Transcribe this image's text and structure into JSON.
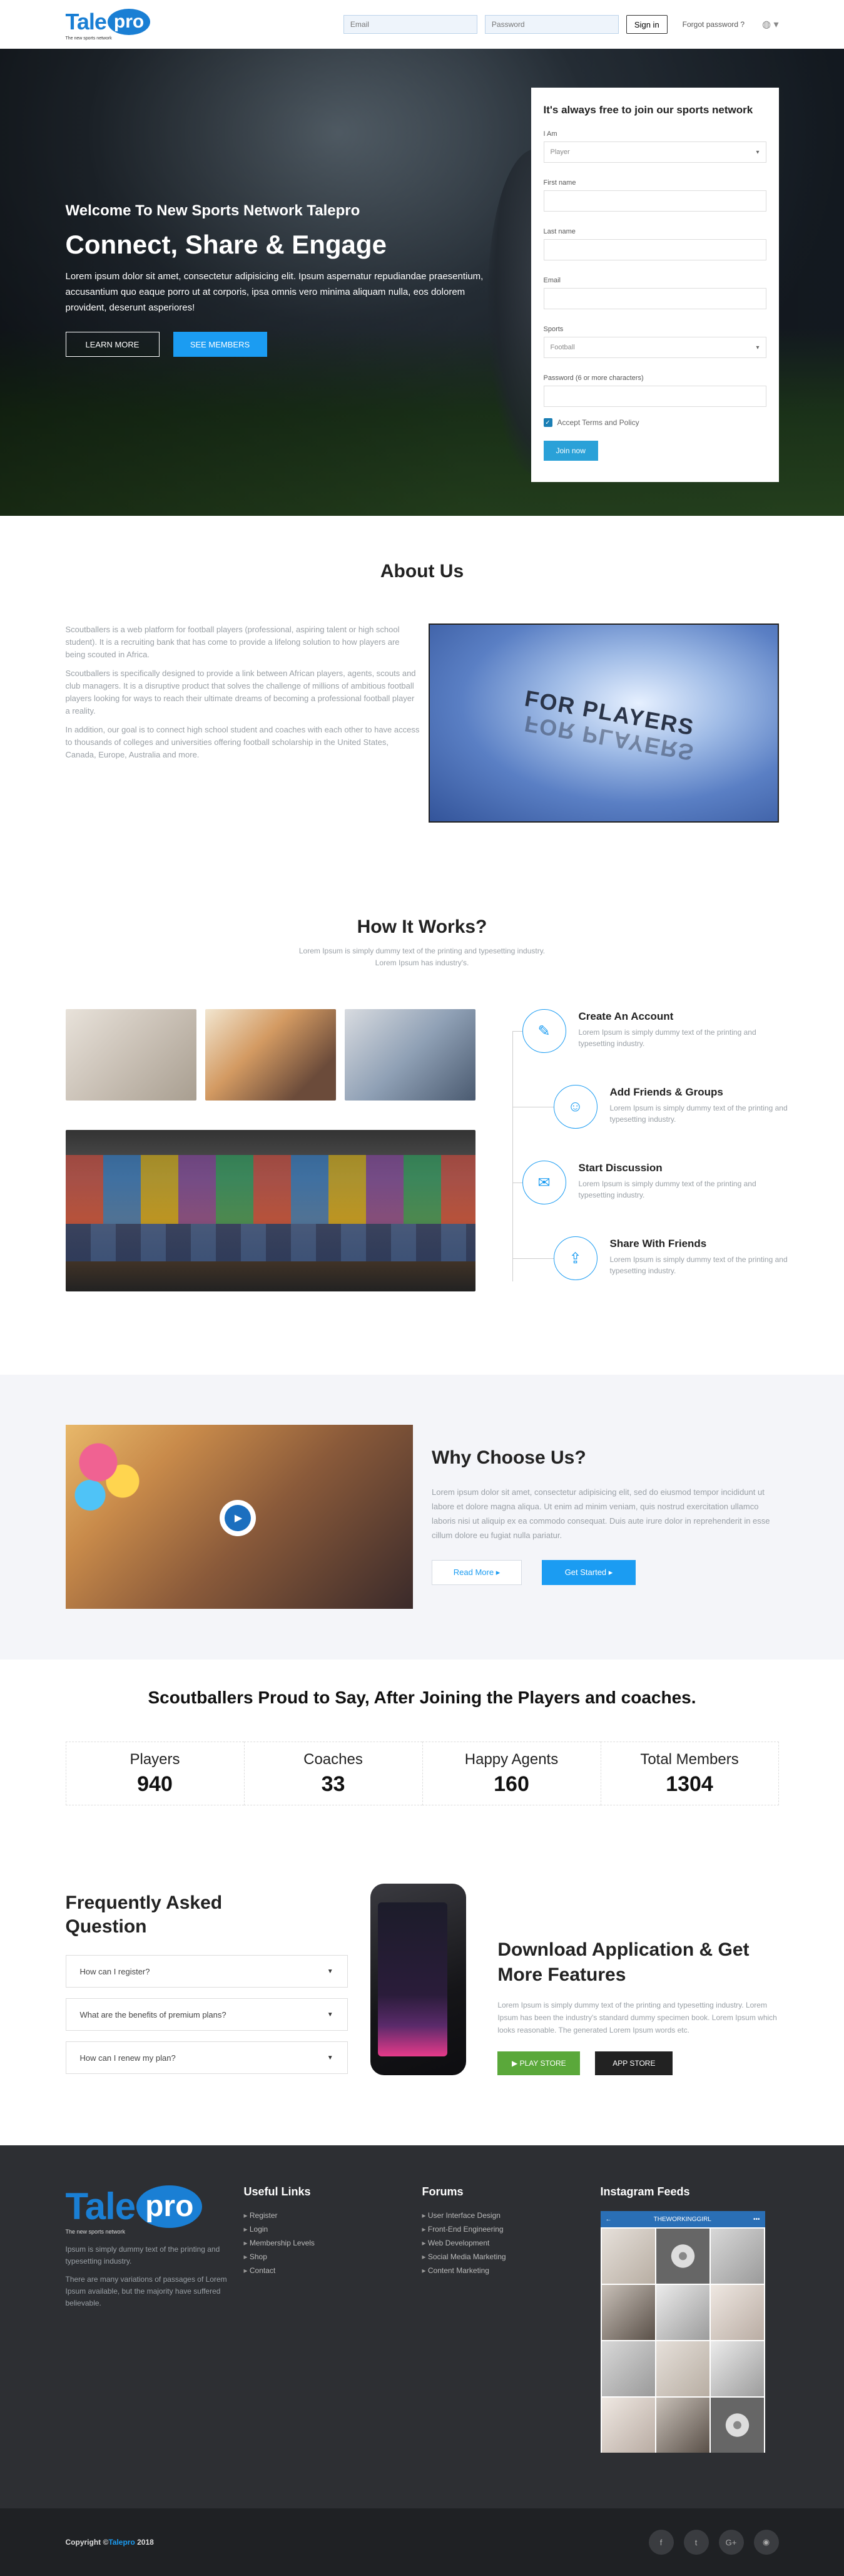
{
  "header": {
    "logo": {
      "tale": "Tale",
      "pro": "pro",
      "tagline": "The new sports network"
    },
    "email_placeholder": "Email",
    "password_placeholder": "Password",
    "signin_label": "Sign in",
    "forgot_label": "Forgot password ?",
    "globe_icon": "globe-icon"
  },
  "hero": {
    "welcome": "Welcome To New Sports Network Talepro",
    "title": "Connect, Share & Engage",
    "description": "Lorem ipsum dolor sit amet, consectetur adipisicing elit. Ipsum aspernatur repudiandae praesentium, accusantium quo eaque porro ut at corporis, ipsa omnis vero minima aliquam nulla, eos dolorem provident, deserunt asperiores!",
    "learn_more": "LEARN MORE",
    "see_members": "SEE MEMBERS"
  },
  "signup": {
    "title": "It's always free to join our sports network",
    "i_am_label": "I Am",
    "i_am_value": "Player",
    "first_name_label": "First name",
    "last_name_label": "Last name",
    "email_label": "Email",
    "sports_label": "Sports",
    "sports_value": "Football",
    "password_label": "Password (6 or more characters)",
    "terms_label": "Accept Terms and Policy",
    "join_label": "Join now"
  },
  "about": {
    "title": "About Us",
    "paragraphs": [
      "Scoutballers is a web platform for football players (professional, aspiring talent or high school student). It is a recruiting bank that has come to provide a lifelong solution to how players are being scouted in Africa.",
      "Scoutballers is specifically designed to provide a link between African players, agents, scouts and club managers. It is a disruptive product that solves the challenge of millions of ambitious football players looking for ways to reach their ultimate dreams of becoming a professional football player a reality.",
      "In addition, our goal is to connect high school student and coaches with each other to have access to thousands of colleges and universities offering football scholarship in the United States, Canada, Europe, Australia and more."
    ],
    "video_text": "FOR PLAYERS"
  },
  "how": {
    "title": "How It Works?",
    "subtitle_line1": "Lorem Ipsum is simply dummy text of the printing and typesetting industry.",
    "subtitle_line2": "Lorem Ipsum has industry's.",
    "steps": [
      {
        "title": "Create An Account",
        "desc": "Lorem Ipsum is simply dummy text of the printing and typesetting industry.",
        "icon": "✎"
      },
      {
        "title": "Add Friends & Groups",
        "desc": "Lorem Ipsum is simply dummy text of the printing and typesetting industry.",
        "icon": "☺"
      },
      {
        "title": "Start Discussion",
        "desc": "Lorem Ipsum is simply dummy text of the printing and typesetting industry.",
        "icon": "✉"
      },
      {
        "title": "Share With Friends",
        "desc": "Lorem Ipsum is simply dummy text of the printing and typesetting industry.",
        "icon": "⇪"
      }
    ]
  },
  "why": {
    "title": "Why Choose Us?",
    "description": "Lorem ipsum dolor sit amet, consectetur adipisicing elit, sed do eiusmod tempor incididunt ut labore et dolore magna aliqua. Ut enim ad minim veniam, quis nostrud exercitation ullamco laboris nisi ut aliquip ex ea commodo consequat. Duis aute irure dolor in reprehenderit in esse cillum dolore eu fugiat nulla pariatur.",
    "read_more": "Read More",
    "get_started": "Get Started"
  },
  "stats": {
    "title": "Scoutballers Proud to Say, After Joining the Players and coaches.",
    "items": [
      {
        "label": "Players",
        "value": "940"
      },
      {
        "label": "Coaches",
        "value": "33"
      },
      {
        "label": "Happy Agents",
        "value": "160"
      },
      {
        "label": "Total Members",
        "value": "1304"
      }
    ]
  },
  "faq": {
    "title_line1": "Frequently Asked",
    "title_line2": "Question",
    "items": [
      "How can I register?",
      "What are the benefits of premium plans?",
      "How can I renew my plan?"
    ]
  },
  "app": {
    "title": "Download Application & Get More Features",
    "description": "Lorem Ipsum is simply dummy text of the printing and typesetting industry. Lorem Ipsum has been the industry's standard dummy specimen book. Lorem Ipsum which looks reasonable. The generated Lorem Ipsum words etc.",
    "play_store": "PLAY STORE",
    "app_store": "APP STORE"
  },
  "footer": {
    "about_p1": "Ipsum is simply dummy text of the printing and typesetting industry.",
    "about_p2": "There are many variations of passages of Lorem Ipsum available, but the majority have suffered believable.",
    "useful_links_title": "Useful Links",
    "useful_links": [
      "Register",
      "Login",
      "Membership Levels",
      "Shop",
      "Contact"
    ],
    "forums_title": "Forums",
    "forums": [
      "User Interface Design",
      "Front-End Engineering",
      "Web Development",
      "Social Media Marketing",
      "Content Marketing"
    ],
    "instagram_title": "Instagram Feeds",
    "instagram_user": "THEWORKINGGIRL"
  },
  "bottom": {
    "copyright_prefix": "Copyright ©",
    "brand": "Talepro",
    "year": " 2018",
    "socials": [
      "f",
      "t",
      "G+",
      "rss"
    ]
  },
  "colors": {
    "accent": "#1b9cf2",
    "brand": "#1a7fd4",
    "footer": "#2d2f33"
  }
}
